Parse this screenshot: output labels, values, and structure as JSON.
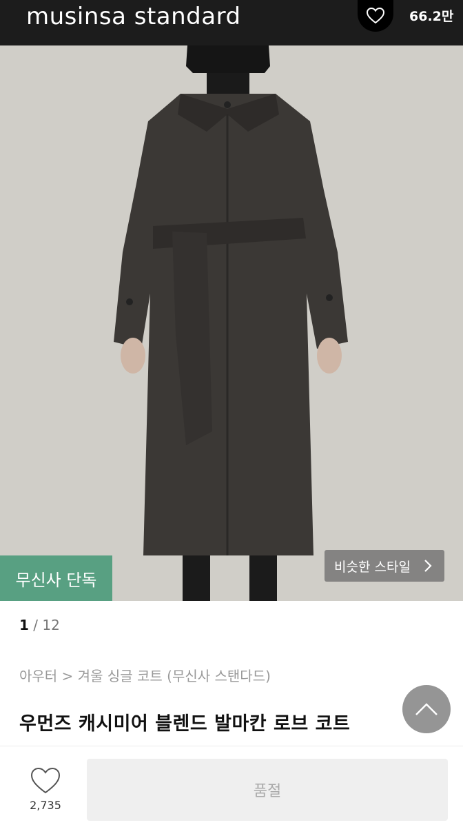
{
  "header": {
    "brand": "musinsa standard",
    "like_count": "66.2만"
  },
  "hero": {
    "exclusive_badge": "무신사 단독",
    "similar_style_label": "비슷한 스타일",
    "colors": {
      "background": "#d0cec8",
      "coat": "#3b3835",
      "badge": "#58a082"
    }
  },
  "pager": {
    "current": "1",
    "separator": " / ",
    "total": "12"
  },
  "product": {
    "breadcrumb": "아우터 > 겨울 싱글 코트 (무신사 스탠다드)",
    "title": "우먼즈 캐시미어 블렌드 발마칸 로브 코트"
  },
  "bottom_bar": {
    "wish_count": "2,735",
    "purchase_label": "품절"
  }
}
